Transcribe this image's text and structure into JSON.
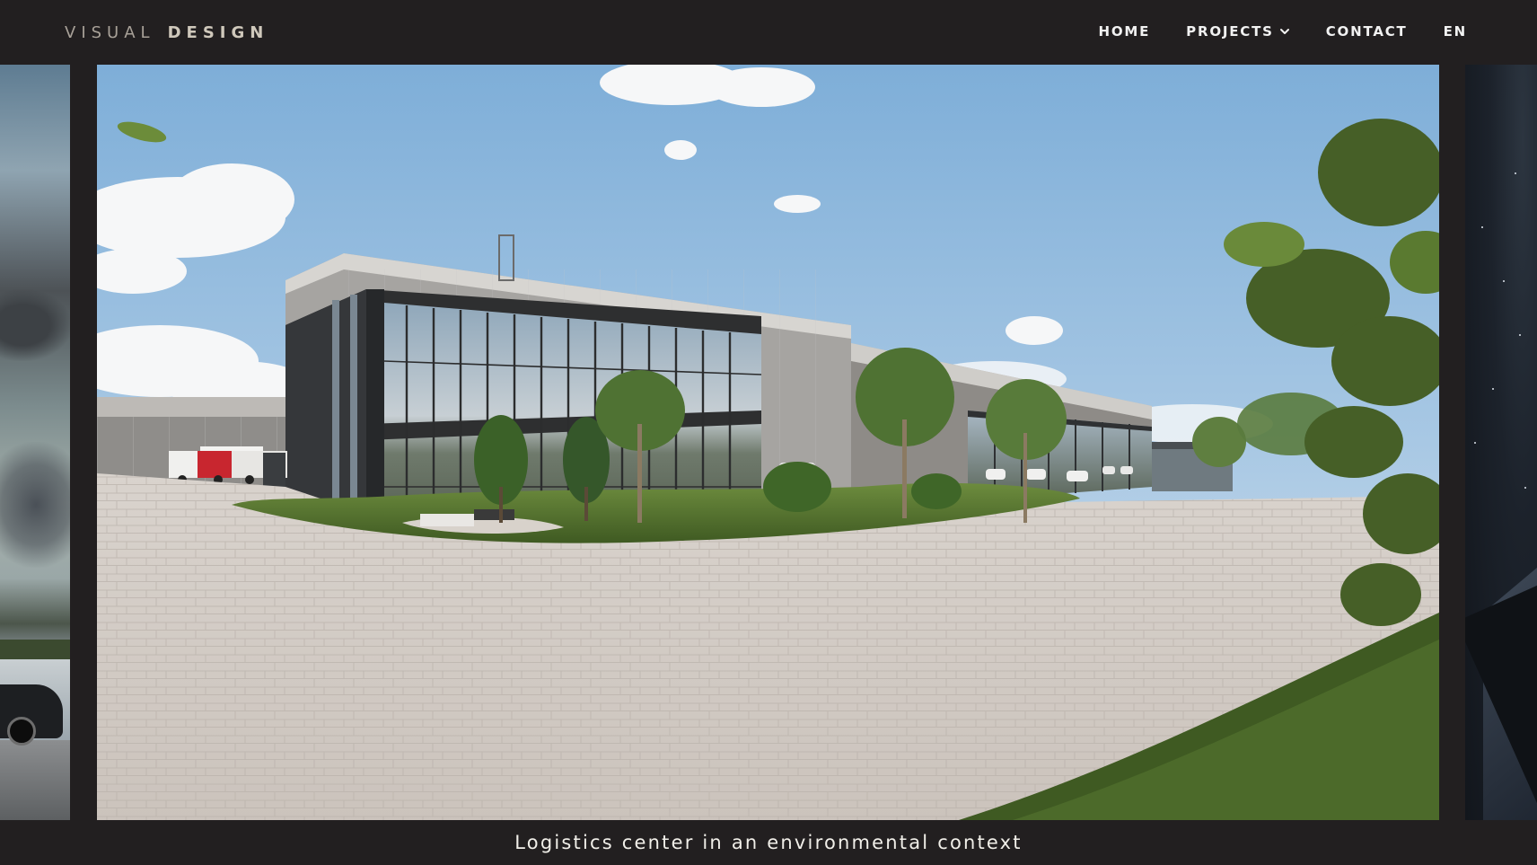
{
  "header": {
    "logo_light": "VISUAL",
    "logo_bold": "DESIGN",
    "nav": {
      "home": "HOME",
      "projects": "PROJECTS",
      "contact": "CONTACT",
      "language": "EN"
    }
  },
  "slide": {
    "caption": "Logistics center in an environmental context"
  },
  "colors": {
    "background": "#221f20",
    "nav_text": "#f2f2f2",
    "logo_text": "#b9b2a6"
  },
  "icons": {
    "projects_dropdown": "chevron-down-icon"
  }
}
